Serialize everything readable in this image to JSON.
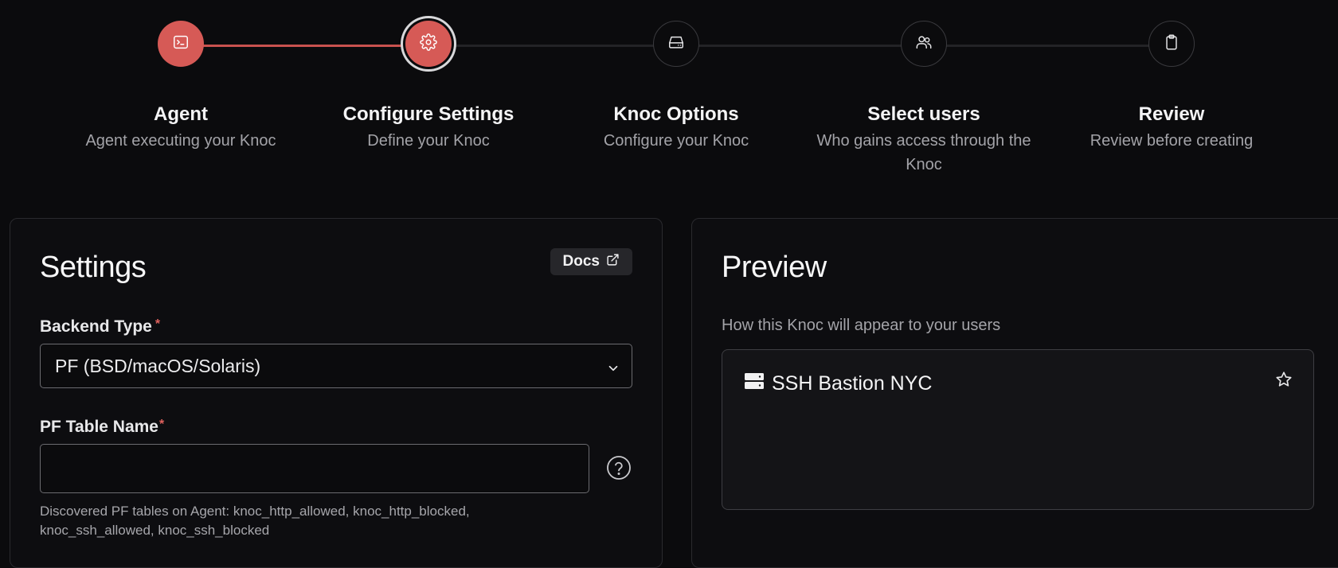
{
  "stepper": {
    "steps": [
      {
        "title": "Agent",
        "subtitle": "Agent executing your Knoc",
        "icon": "terminal-icon",
        "state": "done"
      },
      {
        "title": "Configure Settings",
        "subtitle": "Define your Knoc",
        "icon": "gear-icon",
        "state": "active"
      },
      {
        "title": "Knoc Options",
        "subtitle": "Configure your Knoc",
        "icon": "hard-drive-icon",
        "state": "pending"
      },
      {
        "title": "Select users",
        "subtitle": "Who gains access through the Knoc",
        "icon": "users-icon",
        "state": "pending"
      },
      {
        "title": "Review",
        "subtitle": "Review before creating",
        "icon": "clipboard-icon",
        "state": "pending"
      }
    ],
    "accent_color": "#d65a56"
  },
  "settings": {
    "title": "Settings",
    "docs_label": "Docs",
    "backend_type_label": "Backend Type",
    "backend_type_value": "PF (BSD/macOS/Solaris)",
    "required_mark": "*",
    "pf_table_label": "PF Table Name",
    "pf_table_value": "",
    "pf_table_help": "Discovered PF tables on Agent: knoc_http_allowed, knoc_http_blocked, knoc_ssh_allowed, knoc_ssh_blocked"
  },
  "preview": {
    "title": "Preview",
    "subtitle": "How this Knoc will appear to your users",
    "knoc_name": "SSH Bastion NYC",
    "knoc_icon": "server-icon"
  }
}
